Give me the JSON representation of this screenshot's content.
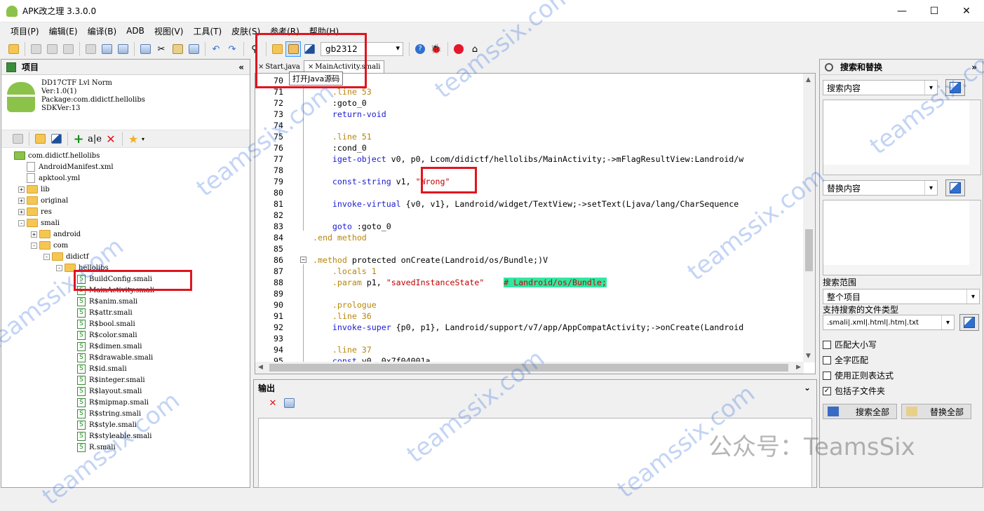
{
  "window": {
    "title": "APK改之理 3.3.0.0",
    "min": "—",
    "max": "☐",
    "close": "✕"
  },
  "menu": [
    "项目(P)",
    "编辑(E)",
    "编译(B)",
    "ADB",
    "视图(V)",
    "工具(T)",
    "皮肤(S)",
    "参考(R)",
    "帮助(H)"
  ],
  "toolbar": {
    "encoding": "gb2312",
    "tooltip": "打开Java源码"
  },
  "project": {
    "title": "项目",
    "info": "DD17CTF Lvl Norm\nVer:1.0(1)\nPackage:com.didictf.hellolibs\nSDKVer:13",
    "tree": [
      {
        "label": "com.didictf.hellolibs",
        "kind": "root",
        "depth": 0
      },
      {
        "label": "AndroidManifest.xml",
        "kind": "file",
        "depth": 1
      },
      {
        "label": "apktool.yml",
        "kind": "file",
        "depth": 1
      },
      {
        "label": "lib",
        "kind": "folder",
        "depth": 1,
        "exp": "+"
      },
      {
        "label": "original",
        "kind": "folder",
        "depth": 1,
        "exp": "+"
      },
      {
        "label": "res",
        "kind": "folder",
        "depth": 1,
        "exp": "+"
      },
      {
        "label": "smali",
        "kind": "folder",
        "depth": 1,
        "exp": "-"
      },
      {
        "label": "android",
        "kind": "folder",
        "depth": 2,
        "exp": "+"
      },
      {
        "label": "com",
        "kind": "folder",
        "depth": 2,
        "exp": "-"
      },
      {
        "label": "didictf",
        "kind": "folder",
        "depth": 3,
        "exp": "-"
      },
      {
        "label": "hellolibs",
        "kind": "folder",
        "depth": 4,
        "exp": "-"
      },
      {
        "label": "BuildConfig.smali",
        "kind": "smali",
        "depth": 5
      },
      {
        "label": "MainActivity.smali",
        "kind": "smali",
        "depth": 5
      },
      {
        "label": "R$anim.smali",
        "kind": "smali",
        "depth": 5
      },
      {
        "label": "R$attr.smali",
        "kind": "smali",
        "depth": 5
      },
      {
        "label": "R$bool.smali",
        "kind": "smali",
        "depth": 5
      },
      {
        "label": "R$color.smali",
        "kind": "smali",
        "depth": 5
      },
      {
        "label": "R$dimen.smali",
        "kind": "smali",
        "depth": 5
      },
      {
        "label": "R$drawable.smali",
        "kind": "smali",
        "depth": 5
      },
      {
        "label": "R$id.smali",
        "kind": "smali",
        "depth": 5
      },
      {
        "label": "R$integer.smali",
        "kind": "smali",
        "depth": 5
      },
      {
        "label": "R$layout.smali",
        "kind": "smali",
        "depth": 5
      },
      {
        "label": "R$mipmap.smali",
        "kind": "smali",
        "depth": 5
      },
      {
        "label": "R$string.smali",
        "kind": "smali",
        "depth": 5
      },
      {
        "label": "R$style.smali",
        "kind": "smali",
        "depth": 5
      },
      {
        "label": "R$styleable.smali",
        "kind": "smali",
        "depth": 5
      },
      {
        "label": "R.smali",
        "kind": "smali",
        "depth": 5
      }
    ]
  },
  "tabs": [
    {
      "label": "Start.java",
      "close": "×",
      "active": false
    },
    {
      "label": "MainActivity.smali",
      "close": "×",
      "active": true
    }
  ],
  "code": [
    {
      "n": "70",
      "segs": []
    },
    {
      "n": "71",
      "segs": [
        [
          "gr",
          "    .line 53"
        ]
      ]
    },
    {
      "n": "72",
      "segs": [
        [
          "",
          "    :goto_0"
        ]
      ]
    },
    {
      "n": "73",
      "segs": [
        [
          "kw",
          "    return-void"
        ]
      ]
    },
    {
      "n": "74",
      "segs": []
    },
    {
      "n": "75",
      "segs": [
        [
          "gr",
          "    .line 51"
        ]
      ]
    },
    {
      "n": "76",
      "segs": [
        [
          "",
          "    :cond_0"
        ]
      ]
    },
    {
      "n": "77",
      "segs": [
        [
          "kw",
          "    iget-object"
        ],
        [
          "",
          " v0, p0, Lcom/didictf/hellolibs/MainActivity;->mFlagResultView:Landroid/w"
        ]
      ]
    },
    {
      "n": "78",
      "segs": []
    },
    {
      "n": "79",
      "segs": [
        [
          "kw",
          "    const-string"
        ],
        [
          "",
          " v1, "
        ],
        [
          "str",
          "\"Wrong\""
        ]
      ]
    },
    {
      "n": "80",
      "segs": []
    },
    {
      "n": "81",
      "segs": [
        [
          "kw",
          "    invoke-virtual"
        ],
        [
          "",
          " {v0, v1}, Landroid/widget/TextView;->setText(Ljava/lang/CharSequence"
        ]
      ]
    },
    {
      "n": "82",
      "segs": []
    },
    {
      "n": "83",
      "segs": [
        [
          "kw",
          "    goto"
        ],
        [
          "",
          " :goto_0"
        ]
      ]
    },
    {
      "n": "84",
      "segs": [
        [
          "gr",
          ".end method"
        ]
      ]
    },
    {
      "n": "85",
      "segs": []
    },
    {
      "n": "86",
      "segs": [
        [
          "gr",
          ".method"
        ],
        [
          "",
          " protected onCreate(Landroid/os/Bundle;)V"
        ]
      ]
    },
    {
      "n": "87",
      "segs": [
        [
          "gr",
          "    .locals 1"
        ]
      ]
    },
    {
      "n": "88",
      "segs": [
        [
          "gr",
          "    .param"
        ],
        [
          "",
          " p1, "
        ],
        [
          "str",
          "\"savedInstanceState\""
        ],
        [
          "",
          "    "
        ],
        [
          "cm",
          "# Landroid/os/Bundle;"
        ]
      ]
    },
    {
      "n": "89",
      "segs": []
    },
    {
      "n": "90",
      "segs": [
        [
          "gr",
          "    .prologue"
        ]
      ]
    },
    {
      "n": "91",
      "segs": [
        [
          "gr",
          "    .line 36"
        ]
      ]
    },
    {
      "n": "92",
      "segs": [
        [
          "kw",
          "    invoke-super"
        ],
        [
          "",
          " {p0, p1}, Landroid/support/v7/app/AppCompatActivity;->onCreate(Landroid"
        ]
      ]
    },
    {
      "n": "93",
      "segs": []
    },
    {
      "n": "94",
      "segs": [
        [
          "gr",
          "    .line 37"
        ]
      ]
    },
    {
      "n": "95",
      "segs": [
        [
          "kw",
          "    const"
        ],
        [
          "",
          " v0, 0x7f04001a"
        ]
      ]
    }
  ],
  "output": {
    "title": "输出"
  },
  "search": {
    "title": "搜索和替换",
    "find_label": "搜索内容",
    "replace_label": "替换内容",
    "scope_label": "搜索范围",
    "scope_value": "整个项目",
    "types_label": "支持搜索的文件类型",
    "types_value": ".smali|.xml|.html|.htm|.txt",
    "options": [
      {
        "label": "匹配大小写",
        "checked": false
      },
      {
        "label": "全字匹配",
        "checked": false
      },
      {
        "label": "使用正则表达式",
        "checked": false
      },
      {
        "label": "包括子文件夹",
        "checked": true
      }
    ],
    "search_all": "搜索全部",
    "replace_all": "替换全部"
  },
  "watermark": {
    "text": "teamssix.com",
    "account": "公众号：TeamsSix"
  },
  "colors": {
    "highlight_box": "#e0141e",
    "keyword": "#1b1bd0",
    "directive": "#b8860b",
    "string": "#c00000",
    "comment_bg": "#2fe8a3"
  }
}
